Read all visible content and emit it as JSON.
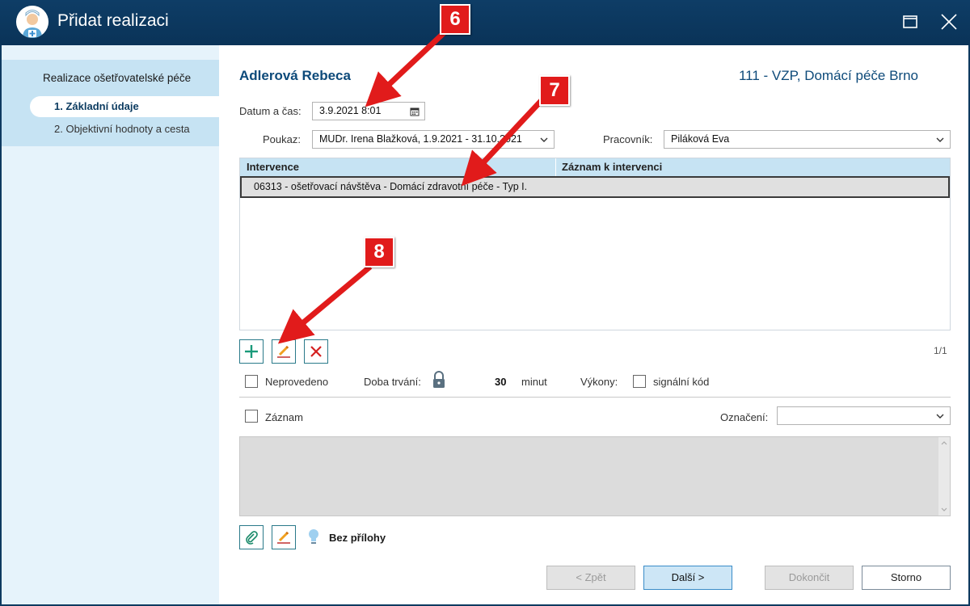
{
  "window": {
    "title": "Přidat realizaci"
  },
  "sidebar": {
    "title": "Realizace ošetřovatelské péče",
    "steps": [
      {
        "label": "1. Základní údaje"
      },
      {
        "label": "2. Objektivní hodnoty a cesta"
      }
    ]
  },
  "header": {
    "patient": "Adlerová Rebeca",
    "insurer": "111 - VZP, Domácí péče Brno"
  },
  "form": {
    "datetime_label": "Datum a čas:",
    "datetime_value": "3.9.2021 8:01",
    "poukaz_label": "Poukaz:",
    "poukaz_value": "MUDr. Irena Blažková, 1.9.2021 - 31.10.2021",
    "worker_label": "Pracovník:",
    "worker_value": "Piláková Eva"
  },
  "grid": {
    "columns": [
      "Intervence",
      "Záznam k intervenci"
    ],
    "rows": [
      {
        "intervention": "06313 - ošetřovací návštěva - Domácí zdravotní péče - Typ I.",
        "note": ""
      }
    ],
    "pager": "1/1"
  },
  "options": {
    "not_done_label": "Neprovedeno",
    "duration_label": "Doba trvání:",
    "duration_value": "30",
    "duration_unit": "minut",
    "performances_label": "Výkony:",
    "signal_code_label": "signální kód",
    "record_label": "Záznam",
    "tag_label": "Označení:",
    "tag_value": ""
  },
  "attachments": {
    "label": "Bez přílohy"
  },
  "buttons": {
    "back": "< Zpět",
    "next": "Další >",
    "finish": "Dokončit",
    "cancel": "Storno"
  },
  "callouts": [
    "6",
    "7",
    "8"
  ],
  "colors": {
    "titlebar": "#0e3d66",
    "accent": "#0d4a7a",
    "callout": "#e11b1b",
    "add": "#1a9a7a",
    "delete": "#d42020"
  }
}
